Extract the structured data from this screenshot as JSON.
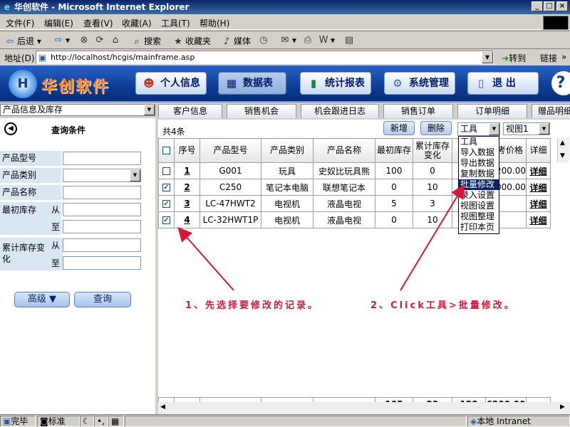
{
  "window": {
    "title": "华创软件 - Microsoft Internet Explorer",
    "min": "_",
    "max": "□",
    "close": "×"
  },
  "menu": [
    "文件(F)",
    "编辑(E)",
    "查看(V)",
    "收藏(A)",
    "工具(T)",
    "帮助(H)"
  ],
  "toolbar": {
    "back": "后退",
    "search": "搜索",
    "favorites": "收藏夹",
    "media": "媒体"
  },
  "address": {
    "label": "地址(D)",
    "url": "http://localhost/hcgis/mainframe.asp",
    "go": "转到",
    "links": "链接"
  },
  "app": {
    "logo_text": "华创软件",
    "nav": [
      "个人信息",
      "数据表",
      "统计报表",
      "系统管理",
      "退 出"
    ],
    "help": "?"
  },
  "left": {
    "module_select": "产品信息及库存",
    "query_title": "查询条件",
    "fields": {
      "model": "产品型号",
      "category": "产品类别",
      "name": "产品名称",
      "initial_stock": "最初库存",
      "stock_change": "累计库存变化",
      "from": "从",
      "to": "至"
    },
    "advanced_button": "高级 ▼",
    "query_button": "查询"
  },
  "tabs": [
    "客户信息",
    "销售机会",
    "机会跟进日志",
    "销售订单",
    "订单明细",
    "赠品明细"
  ],
  "grid": {
    "count": "共4条",
    "new_button": "新增",
    "delete_button": "删除",
    "tool_select": "工具",
    "view_select": "视图1",
    "headers": [
      "序号",
      "产品型号",
      "产品类别",
      "产品名称",
      "最初库存",
      "累计库存变化",
      "参考价格",
      "详细"
    ],
    "rows": [
      {
        "checked": false,
        "seq": "1",
        "model": "G001",
        "category": "玩具",
        "name": "史奴比玩具熊",
        "initial": "100",
        "change": "0",
        "price": "200.00",
        "detail": "详细"
      },
      {
        "checked": true,
        "seq": "2",
        "model": "C250",
        "category": "笔记本电脑",
        "name": "联想笔记本",
        "initial": "0",
        "change": "10",
        "price": "000.00",
        "detail": "详细"
      },
      {
        "checked": true,
        "seq": "3",
        "model": "LC-47HWT2",
        "category": "电视机",
        "name": "液晶电视",
        "initial": "5",
        "change": "3",
        "price": "",
        "detail": "详细"
      },
      {
        "checked": true,
        "seq": "4",
        "model": "LC-32HWT1P",
        "category": "电视机",
        "name": "液晶电视",
        "initial": "0",
        "change": "10",
        "price": "",
        "detail": "详细"
      }
    ],
    "totals": {
      "initial": "105",
      "change": "23",
      "col7": "128",
      "price": "6200.00"
    }
  },
  "tool_menu": [
    "工具",
    "导入数据",
    "导出数据",
    "复制数据",
    "批量修改",
    "录入设置",
    "视图设置",
    "视图整理",
    "打印本页"
  ],
  "notes": {
    "note1": "1、先选择要修改的记录。",
    "note2": "2、Click工具>批量修改。"
  },
  "status": {
    "done": "完毕",
    "ime": "标准",
    "zone": "本地 Intranet"
  },
  "colors": {
    "header_blue": "#0b3d94",
    "accent_orange": "#ff7a1a",
    "note_red": "#d8163a",
    "menu_highlight": "#0a246a"
  }
}
